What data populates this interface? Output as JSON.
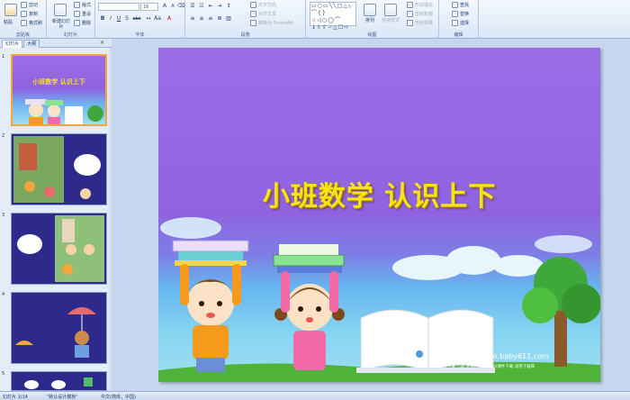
{
  "ribbon": {
    "clipboard": {
      "paste": "粘贴",
      "cut": "剪切",
      "copy": "复制",
      "format_painter": "格式刷",
      "label": "剪贴板"
    },
    "slides": {
      "new_slide": "新建幻灯片",
      "layout": "版式",
      "reset": "重设",
      "delete": "删除",
      "label": "幻灯片"
    },
    "font": {
      "size_value": "16",
      "bold": "B",
      "italic": "I",
      "underline": "U",
      "shadow": "S",
      "strike": "abc",
      "label": "字体"
    },
    "paragraph": {
      "text_direction": "文字方向",
      "align_text": "对齐文本",
      "smartart": "转换为 SmartArt",
      "label": "段落"
    },
    "drawing": {
      "arrange": "排列",
      "quick_styles": "快速样式",
      "shape_fill": "形状填充",
      "shape_outline": "形状轮廓",
      "shape_effects": "形状效果",
      "label": "绘图"
    },
    "editing": {
      "find": "查找",
      "replace": "替换",
      "select": "选择",
      "label": "编辑"
    }
  },
  "panel": {
    "tab_slides": "幻灯片",
    "tab_outline": "大纲",
    "close": "×",
    "slide_numbers": [
      "1",
      "2",
      "3",
      "4",
      "5"
    ],
    "thumb1_title": "小班数学 认识上下"
  },
  "slide": {
    "title": "小班数学 认识上下",
    "footer_site": "幼教资源网站  ziyuan.baby611.com",
    "footer_links": "课件下载   儿歌   故事MP3   FLASH课件下载   试卷下载库"
  },
  "status": {
    "slide_counter": "幻灯片 1/14",
    "theme": "\"默认设计模板\"",
    "language": "中文(简体，中国)"
  },
  "colors": {
    "slide_top": "#9c6de7",
    "title": "#f7e414",
    "thumb_dark": "#2d2a8c",
    "selection": "#f3a63b"
  }
}
